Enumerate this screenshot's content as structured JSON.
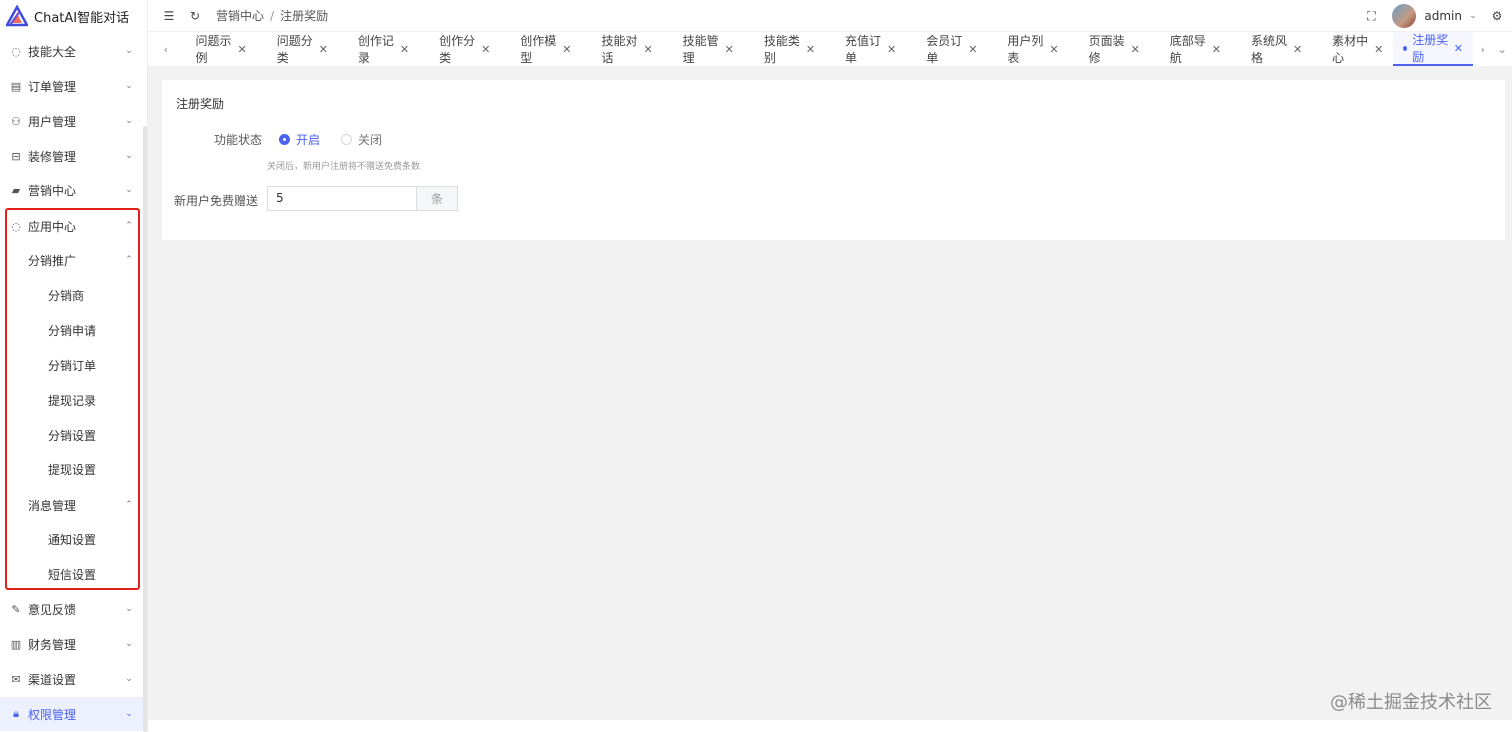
{
  "app": {
    "title": "ChatAI智能对话"
  },
  "colors": {
    "accent": "#4a61f2",
    "highlight_border": "#e0201b"
  },
  "sidebar": {
    "items": [
      {
        "label": "技能大全",
        "icon": "compass-icon",
        "arrow": "chevron-down"
      },
      {
        "label": "订单管理",
        "icon": "database-icon",
        "arrow": "chevron-down"
      },
      {
        "label": "用户管理",
        "icon": "user-icon",
        "arrow": "chevron-down"
      },
      {
        "label": "装修管理",
        "icon": "brush-icon",
        "arrow": "chevron-down"
      },
      {
        "label": "营销中心",
        "icon": "briefcase-icon",
        "arrow": "chevron-down"
      },
      {
        "label": "应用中心",
        "icon": "compass-icon",
        "arrow": "chevron-up"
      },
      {
        "label": "分销推广",
        "arrow": "chevron-up"
      },
      {
        "label": "分销商"
      },
      {
        "label": "分销申请"
      },
      {
        "label": "分销订单"
      },
      {
        "label": "提现记录"
      },
      {
        "label": "分销设置"
      },
      {
        "label": "提现设置"
      },
      {
        "label": "消息管理",
        "arrow": "chevron-up"
      },
      {
        "label": "通知设置"
      },
      {
        "label": "短信设置"
      },
      {
        "label": "意见反馈",
        "icon": "edit-icon",
        "arrow": "chevron-down"
      },
      {
        "label": "财务管理",
        "icon": "chart-icon",
        "arrow": "chevron-down"
      },
      {
        "label": "渠道设置",
        "icon": "mail-icon",
        "arrow": "chevron-down"
      },
      {
        "label": "权限管理",
        "icon": "lock-icon",
        "arrow": "chevron-down"
      }
    ]
  },
  "header": {
    "breadcrumb": [
      "营销中心",
      "注册奖励"
    ],
    "username": "admin"
  },
  "tabs": [
    {
      "label": "问题示例"
    },
    {
      "label": "问题分类"
    },
    {
      "label": "创作记录"
    },
    {
      "label": "创作分类"
    },
    {
      "label": "创作模型"
    },
    {
      "label": "技能对话"
    },
    {
      "label": "技能管理"
    },
    {
      "label": "技能类别"
    },
    {
      "label": "充值订单"
    },
    {
      "label": "会员订单"
    },
    {
      "label": "用户列表"
    },
    {
      "label": "页面装修"
    },
    {
      "label": "底部导航"
    },
    {
      "label": "系统风格"
    },
    {
      "label": "素材中心"
    },
    {
      "label": "注册奖励",
      "active": true
    }
  ],
  "form": {
    "title": "注册奖励",
    "status_label": "功能状态",
    "option_on": "开启",
    "option_off": "关闭",
    "selected": "开启",
    "hint": "关闭后，新用户注册将不赠送免费条数",
    "free_label": "新用户免费赠送",
    "free_value": "5",
    "free_unit": "条"
  },
  "watermark": "@稀土掘金技术社区"
}
